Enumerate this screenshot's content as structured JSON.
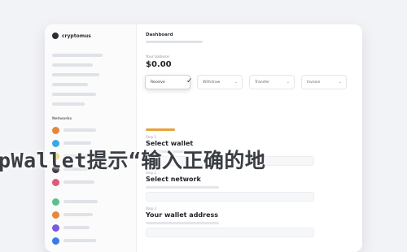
{
  "sidebar": {
    "brand": "cryptomus",
    "section_title": "Networks",
    "coin_colors": [
      "#e8863a",
      "#3aa7e8",
      "#e8c23a",
      "#2b2d33",
      "#e05a7a",
      "#5bbf8e",
      "#e8863a",
      "#7a5be0",
      "#3a7ae8"
    ]
  },
  "main": {
    "dashboard_title": "Dashboard",
    "balance_label": "Your balance",
    "balance_value": "$0.00",
    "actions": [
      {
        "label": "Receive",
        "active": true
      },
      {
        "label": "Withdraw",
        "active": false
      },
      {
        "label": "Transfer",
        "active": false
      },
      {
        "label": "Invoice",
        "active": false
      }
    ],
    "steps": [
      {
        "label": "Step 1",
        "title": "Select wallet"
      },
      {
        "label": "Step 2",
        "title": "Select network"
      },
      {
        "label": "Step 3",
        "title": "Your wallet address"
      }
    ]
  },
  "overlay": {
    "text": "pWallet提示“输入正确的地"
  }
}
